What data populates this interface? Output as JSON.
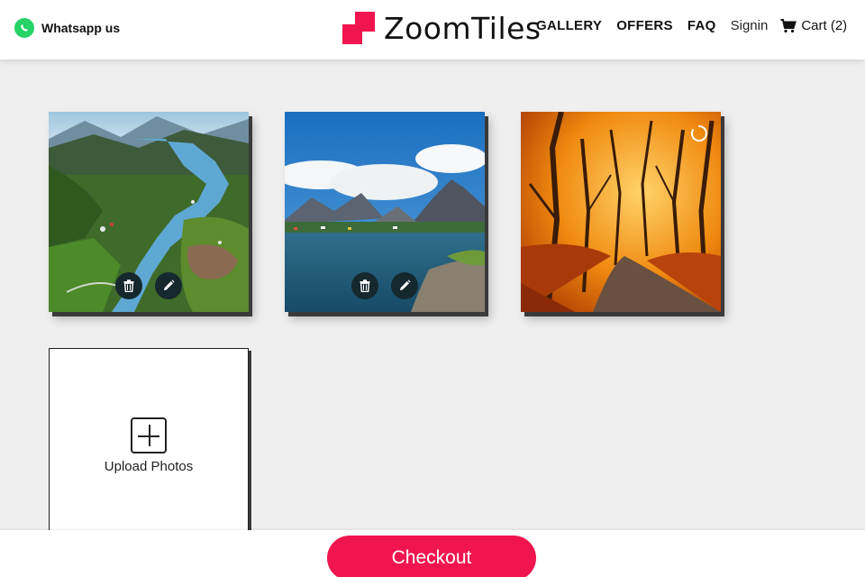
{
  "header": {
    "whatsapp_label": "Whatsapp us",
    "logo_text": "ZoomTiles",
    "nav": [
      {
        "label": "GALLERY"
      },
      {
        "label": "OFFERS"
      },
      {
        "label": "FAQ"
      }
    ],
    "signin_label": "Signin",
    "cart_label": "Cart (2)"
  },
  "tiles": [
    {
      "subject": "aerial fjord valley with river",
      "actions": [
        "trash-icon",
        "edit-pencil-icon"
      ]
    },
    {
      "subject": "lake with mountains and clouds",
      "actions": [
        "trash-icon",
        "edit-pencil-icon"
      ]
    },
    {
      "subject": "autumn forest path",
      "status": "loading-spinner-icon"
    }
  ],
  "upload": {
    "label": "Upload Photos",
    "icon": "plus-square-icon"
  },
  "footer": {
    "checkout_label": "Checkout"
  },
  "colors": {
    "brand": "#f0154e",
    "whatsapp": "#25d366",
    "action_button": "#15282d"
  }
}
